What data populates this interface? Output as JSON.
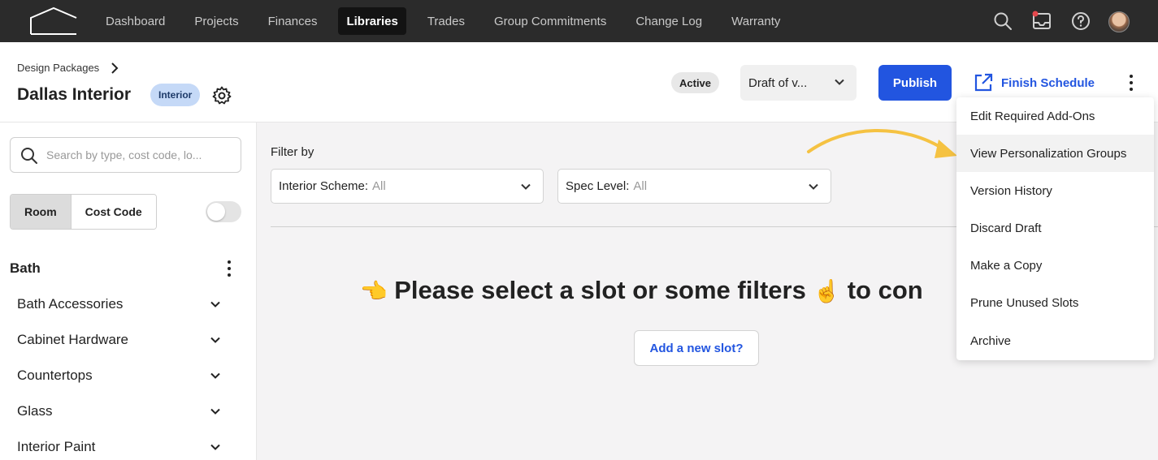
{
  "nav": {
    "items": [
      "Dashboard",
      "Projects",
      "Finances",
      "Libraries",
      "Trades",
      "Group Commitments",
      "Change Log",
      "Warranty"
    ],
    "active_index": 3
  },
  "header": {
    "breadcrumb": "Design Packages",
    "title": "Dallas Interior",
    "tag": "Interior",
    "status": "Active",
    "version": "Draft of v...",
    "publish_label": "Publish",
    "finish_schedule_label": "Finish Schedule"
  },
  "sidebar": {
    "search_placeholder": "Search by type, cost code, lo...",
    "segments": [
      "Room",
      "Cost Code"
    ],
    "active_segment": 0,
    "group_title": "Bath",
    "items": [
      "Bath Accessories",
      "Cabinet Hardware",
      "Countertops",
      "Glass",
      "Interior Paint"
    ]
  },
  "main": {
    "filter_label": "Filter by",
    "filters": [
      {
        "label": "Interior Scheme:",
        "value": "All"
      },
      {
        "label": "Spec Level:",
        "value": "All"
      }
    ],
    "empty_emoji_left": "👈",
    "empty_text": "Please select a slot or some filters",
    "empty_emoji_right": "☝️",
    "empty_tail": "to con",
    "add_slot_label": "Add a new slot?"
  },
  "menu": {
    "items": [
      "Edit Required Add-Ons",
      "View Personalization Groups",
      "Version History",
      "Discard Draft",
      "Make a Copy",
      "Prune Unused Slots",
      "Archive"
    ],
    "highlighted_index": 1
  },
  "colors": {
    "accent": "#2255e0",
    "nav_bg": "#2b2b2b",
    "tag_bg": "#c5d9f7",
    "annotation_arrow": "#f5c242"
  }
}
